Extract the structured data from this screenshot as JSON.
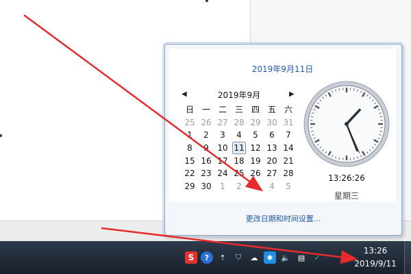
{
  "popup": {
    "long_date": "2019年9月11日",
    "calendar": {
      "month_title": "2019年9月",
      "weekdays": [
        "日",
        "一",
        "二",
        "三",
        "四",
        "五",
        "六"
      ],
      "weeks": [
        [
          {
            "d": "25",
            "o": true
          },
          {
            "d": "26",
            "o": true
          },
          {
            "d": "27",
            "o": true
          },
          {
            "d": "28",
            "o": true
          },
          {
            "d": "29",
            "o": true
          },
          {
            "d": "30",
            "o": true
          },
          {
            "d": "31",
            "o": true
          }
        ],
        [
          {
            "d": "1"
          },
          {
            "d": "2"
          },
          {
            "d": "3"
          },
          {
            "d": "4"
          },
          {
            "d": "5"
          },
          {
            "d": "6"
          },
          {
            "d": "7"
          }
        ],
        [
          {
            "d": "8"
          },
          {
            "d": "9"
          },
          {
            "d": "10"
          },
          {
            "d": "11",
            "today": true
          },
          {
            "d": "12"
          },
          {
            "d": "13"
          },
          {
            "d": "14"
          }
        ],
        [
          {
            "d": "15"
          },
          {
            "d": "16"
          },
          {
            "d": "17"
          },
          {
            "d": "18"
          },
          {
            "d": "19"
          },
          {
            "d": "20"
          },
          {
            "d": "21"
          }
        ],
        [
          {
            "d": "22"
          },
          {
            "d": "23"
          },
          {
            "d": "24"
          },
          {
            "d": "25"
          },
          {
            "d": "26"
          },
          {
            "d": "27"
          },
          {
            "d": "28"
          }
        ],
        [
          {
            "d": "29"
          },
          {
            "d": "30"
          },
          {
            "d": "1",
            "o": true
          },
          {
            "d": "2",
            "o": true
          },
          {
            "d": "3",
            "o": true
          },
          {
            "d": "4",
            "o": true
          },
          {
            "d": "5",
            "o": true
          }
        ]
      ]
    },
    "time": "13:26:26",
    "weekday": "星期三",
    "settings_link": "更改日期和时间设置..."
  },
  "taskbar": {
    "tray_icons": [
      {
        "name": "sogou-ime-icon",
        "glyph": "S"
      },
      {
        "name": "help-icon",
        "glyph": "?"
      },
      {
        "name": "tray-expand-icon",
        "glyph": "⇡"
      },
      {
        "name": "shield-icon",
        "glyph": "⛉"
      },
      {
        "name": "cloud-icon",
        "glyph": "☁"
      },
      {
        "name": "star-app-icon",
        "glyph": "✱"
      },
      {
        "name": "volume-icon",
        "glyph": "🔈"
      },
      {
        "name": "clipboard-icon",
        "glyph": "▤"
      },
      {
        "name": "network-icon",
        "glyph": "✓"
      }
    ],
    "clock_time": "13:26",
    "clock_date": "2019/9/11"
  },
  "colors": {
    "accent": "#1e5aa8",
    "arrow": "#e52b2b"
  }
}
